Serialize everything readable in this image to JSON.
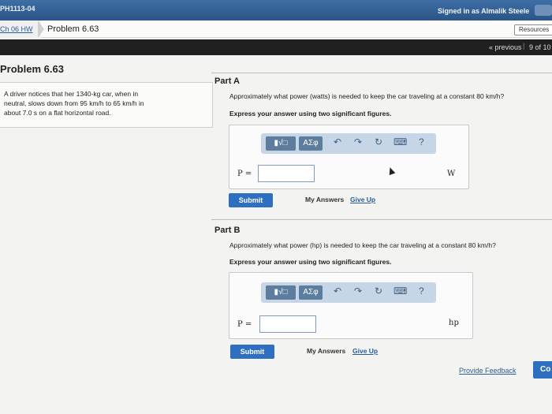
{
  "header": {
    "course_code": "PH1113-04",
    "signed_in": "Signed in as Almalik Steele"
  },
  "breadcrumb": {
    "hw_link": "Ch 06 HW",
    "problem": "Problem 6.63",
    "resources": "Resources"
  },
  "nav": {
    "previous": "« previous",
    "position": "9 of 10"
  },
  "problem": {
    "title": "Problem 6.63",
    "text_line1": "A driver notices that her 1340-kg car, when in",
    "text_line2": "neutral, slows down from 95 km/h to 65 km/h in",
    "text_line3": "about 7.0 s on a flat horizontal road."
  },
  "partA": {
    "label": "Part A",
    "question": "Approximately what power (watts) is needed to keep the car traveling at a constant 80 km/h?",
    "instruction": "Express your answer using two significant figures.",
    "variable": "P =",
    "unit": "W",
    "value": "",
    "submit": "Submit",
    "my_answers": "My Answers",
    "give_up": "Give Up"
  },
  "partB": {
    "label": "Part B",
    "question": "Approximately what power (hp) is needed to keep the car traveling at a constant 80 km/h?",
    "instruction": "Express your answer using two significant figures.",
    "variable": "P =",
    "unit": "hp",
    "value": "",
    "submit": "Submit",
    "my_answers": "My Answers",
    "give_up": "Give Up"
  },
  "toolbar": {
    "templates_label": "▮√□",
    "greek_label": "ΑΣφ",
    "undo_icon": "↶",
    "redo_icon": "↷",
    "reset_icon": "↻",
    "keyboard_icon": "⌨",
    "help_icon": "?"
  },
  "footer": {
    "feedback": "Provide Feedback",
    "continue": "Co"
  },
  "colors": {
    "accent": "#2f6fbf",
    "header": "#2c5486",
    "nav": "#202020"
  }
}
